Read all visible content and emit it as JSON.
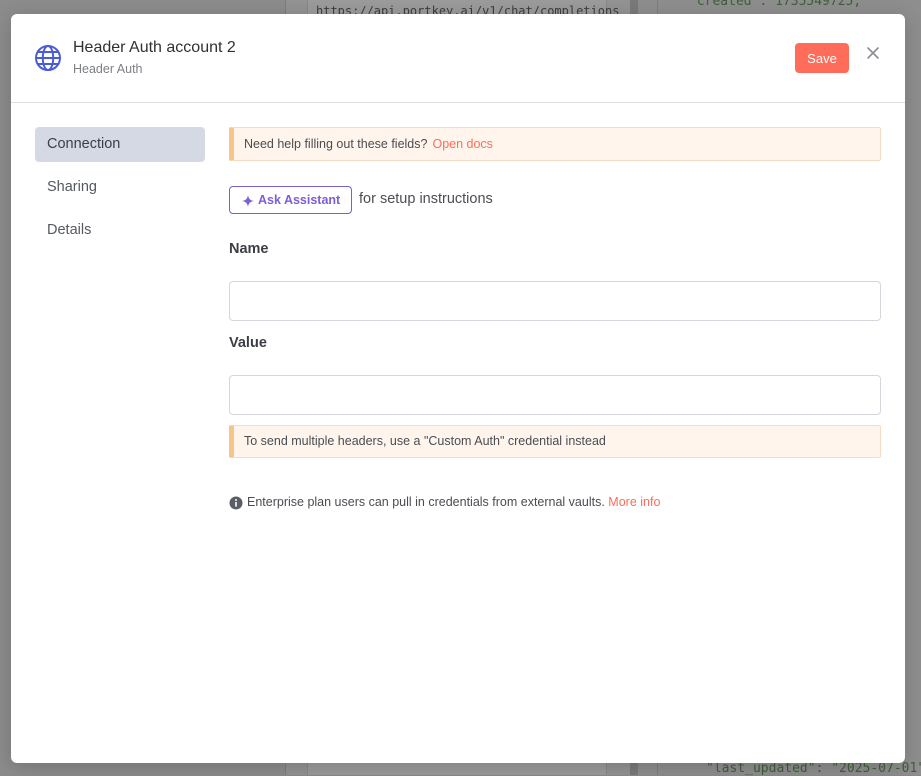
{
  "background": {
    "fragments": [
      "https://api.portkey.ai/v1/chat/completions",
      "\"created\": 1735549725,",
      "\"last_updated\": \"2025-07-01\""
    ]
  },
  "modal": {
    "title": "Header Auth account 2",
    "subtitle": "Header Auth",
    "save_label": "Save",
    "icons": {
      "credential": "globe-icon",
      "close": "close-icon"
    },
    "sidebar": {
      "items": [
        {
          "label": "Connection",
          "active": true
        },
        {
          "label": "Sharing",
          "active": false
        },
        {
          "label": "Details",
          "active": false
        }
      ]
    },
    "help_notice": {
      "text": "Need help filling out these fields?",
      "link": "Open docs"
    },
    "assistant": {
      "button_label": "Ask Assistant",
      "suffix": "for setup instructions"
    },
    "fields": {
      "name": {
        "label": "Name",
        "value": ""
      },
      "value": {
        "label": "Value",
        "value": ""
      }
    },
    "headers_notice": {
      "text": "To send multiple headers, use a \"Custom Auth\" credential instead"
    },
    "enterprise": {
      "text": "Enterprise plan users can pull in credentials from external vaults.",
      "link": "More info"
    }
  },
  "colors": {
    "accent": "#ff6d5a",
    "assistant": "#7a5fd6",
    "notice_bg": "#fff5ec",
    "notice_border": "#f5c58a",
    "active_nav": "#d5d9e4"
  }
}
